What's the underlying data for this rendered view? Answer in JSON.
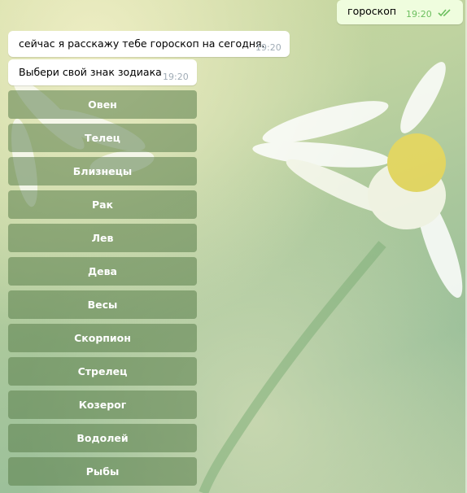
{
  "messages": [
    {
      "direction": "outgoing",
      "text": "гороскоп",
      "time": "19:20",
      "status": "read-double-check"
    },
    {
      "direction": "incoming",
      "text": "сейчас я расскажу тебе гороскоп на сегодня.",
      "time": "19:20"
    },
    {
      "direction": "incoming",
      "text": "Выбери свой знак зодиака",
      "time": "19:20"
    }
  ],
  "keyboard": {
    "buttons": [
      "Овен",
      "Телец",
      "Близнецы",
      "Рак",
      "Лев",
      "Дева",
      "Весы",
      "Скорпион",
      "Стрелец",
      "Козерог",
      "Водолей",
      "Рыбы"
    ]
  },
  "colors": {
    "outgoing_bubble": "#effdde",
    "incoming_bubble": "#ffffff",
    "keyboard_button": "#5a7d4b",
    "read_check": "#6cbf5f"
  }
}
